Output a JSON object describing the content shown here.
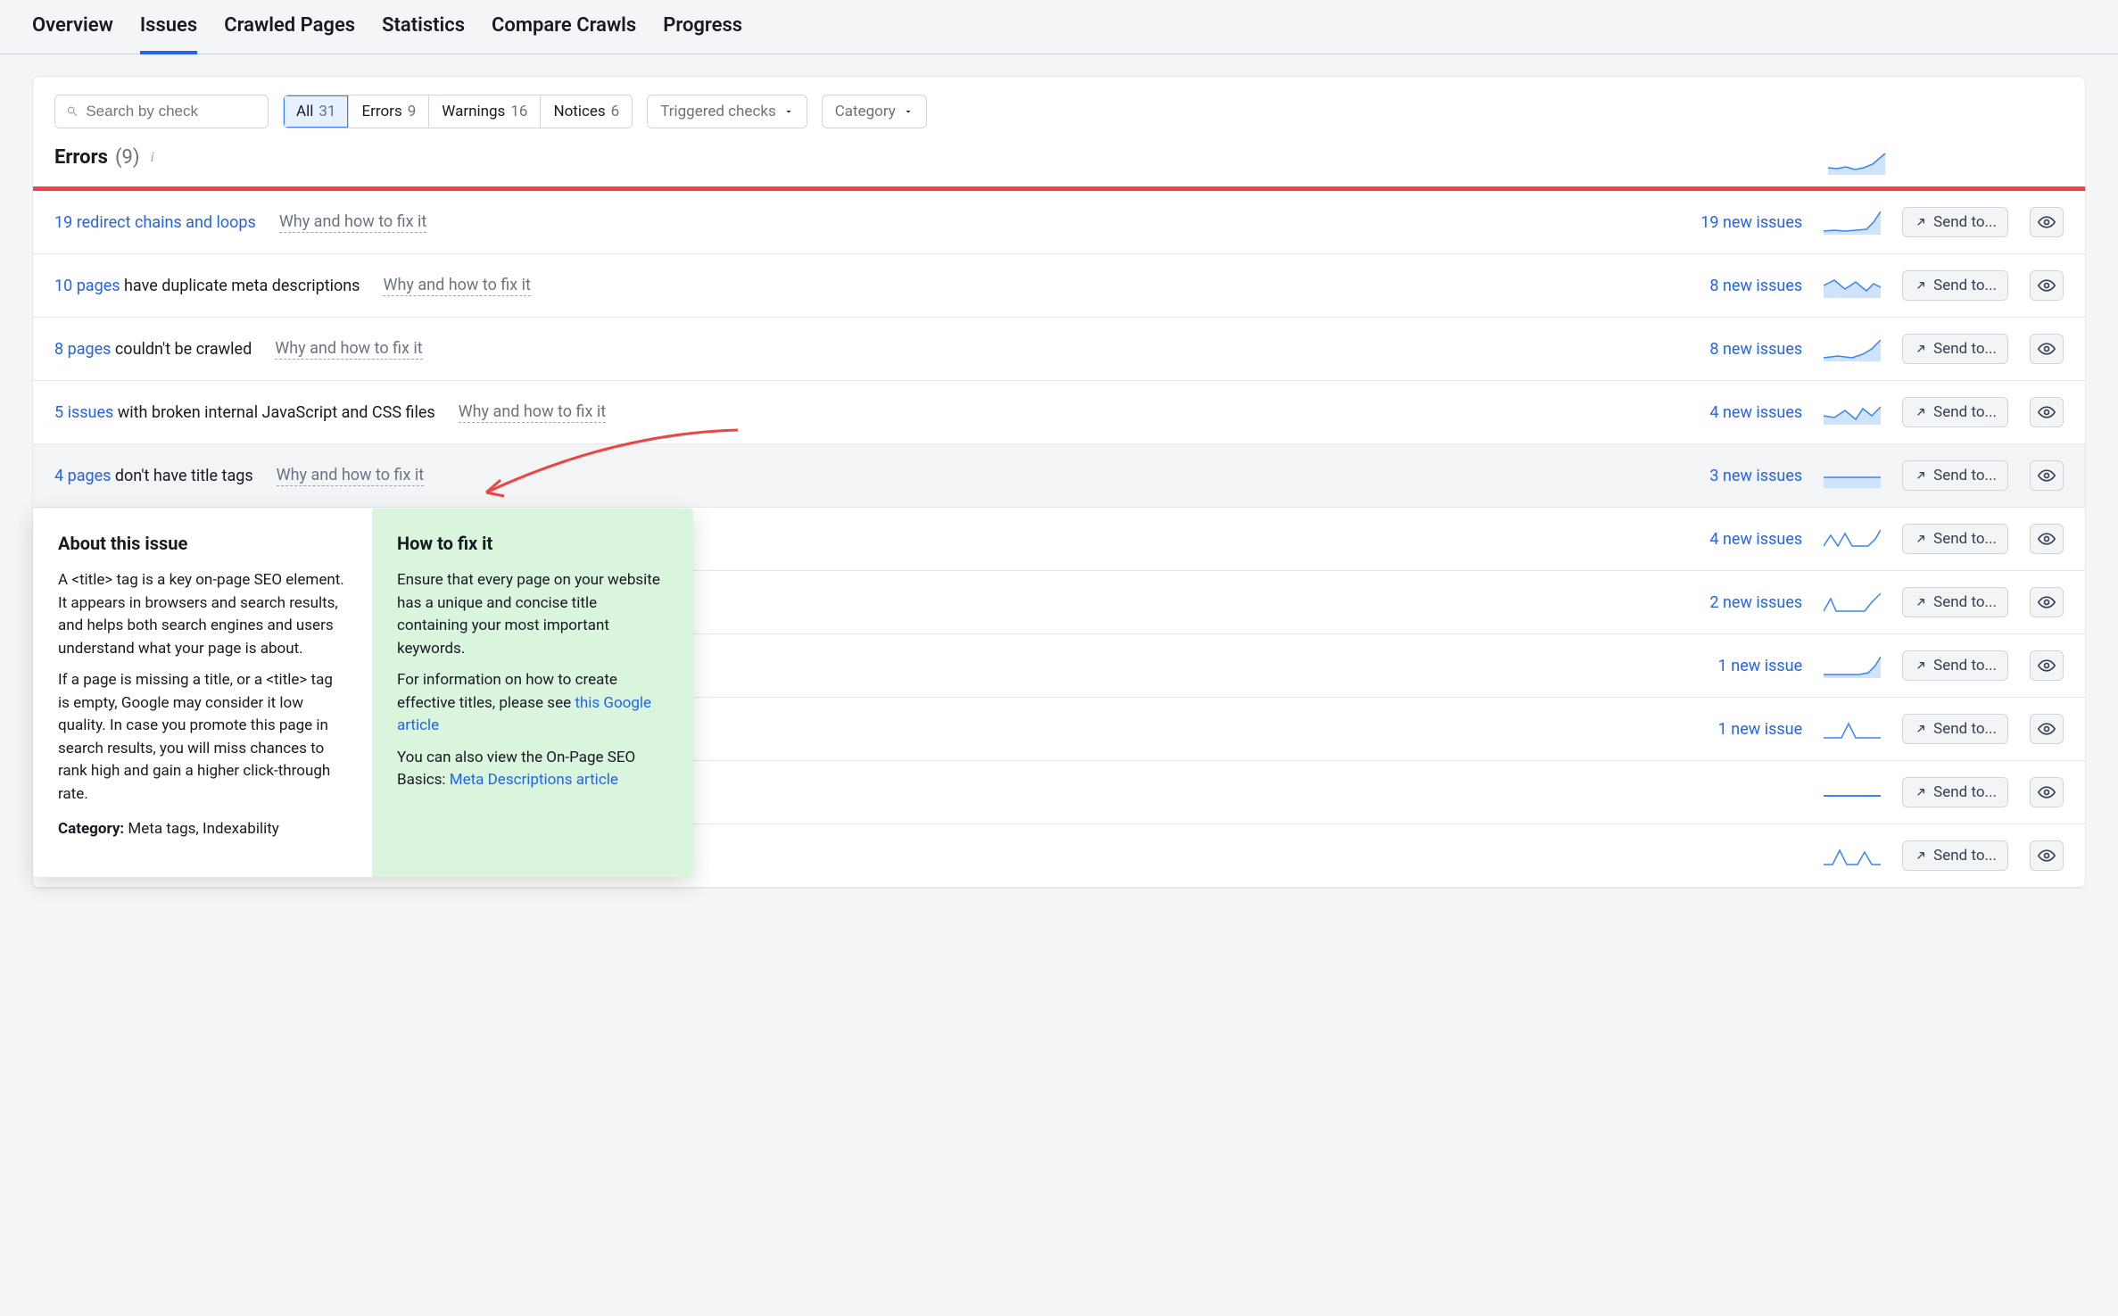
{
  "tabs": [
    "Overview",
    "Issues",
    "Crawled Pages",
    "Statistics",
    "Compare Crawls",
    "Progress"
  ],
  "active_tab": 1,
  "search": {
    "placeholder": "Search by check"
  },
  "filters": {
    "pills": [
      {
        "label": "All",
        "count": "31"
      },
      {
        "label": "Errors",
        "count": "9"
      },
      {
        "label": "Warnings",
        "count": "16"
      },
      {
        "label": "Notices",
        "count": "6"
      }
    ],
    "active_pill": 0,
    "dropdowns": [
      {
        "label": "Triggered checks"
      },
      {
        "label": "Category"
      }
    ]
  },
  "section": {
    "title": "Errors",
    "count": "(9)",
    "info": "i"
  },
  "rows": [
    {
      "link": "19 redirect chains and loops",
      "desc": "",
      "why": "Why and how to fix it",
      "new": "19 new issues"
    },
    {
      "link": "10 pages",
      "desc": "have duplicate meta descriptions",
      "why": "Why and how to fix it",
      "new": "8 new issues"
    },
    {
      "link": "8 pages",
      "desc": "couldn't be crawled",
      "why": "Why and how to fix it",
      "new": "8 new issues"
    },
    {
      "link": "5 issues",
      "desc": "with broken internal JavaScript and CSS files",
      "why": "Why and how to fix it",
      "new": "4 new issues"
    },
    {
      "link": "4 pages",
      "desc": "don't have title tags",
      "why": "Why and how to fix it",
      "new": "3 new issues",
      "highlight": true
    },
    {
      "link": "",
      "desc": "",
      "why": "",
      "new": "4 new issues"
    },
    {
      "link": "",
      "desc": "",
      "why": "",
      "new": "2 new issues"
    },
    {
      "link": "",
      "desc": "",
      "why": "",
      "new": "1 new issue"
    },
    {
      "link": "",
      "desc": "",
      "why": "",
      "new": "1 new issue"
    },
    {
      "link": "",
      "desc": "",
      "why": "",
      "new": ""
    },
    {
      "link": "",
      "desc": "",
      "why": "",
      "new": ""
    }
  ],
  "sendto": "Send to...",
  "popover": {
    "about_title": "About this issue",
    "about_p1": "A <title> tag is a key on-page SEO element. It appears in browsers and search results, and helps both search engines and users understand what your page is about.",
    "about_p2": "If a page is missing a title, or a <title> tag is empty, Google may consider it low quality. In case you promote this page in search results, you will miss chances to rank high and gain a higher click-through rate.",
    "about_cat_label": "Category:",
    "about_cat_val": "Meta tags, Indexability",
    "fix_title": "How to fix it",
    "fix_p1": "Ensure that every page on your website has a unique and concise title containing your most important keywords.",
    "fix_p2_a": "For information on how to create effective titles, please see ",
    "fix_p2_link": "this Google article",
    "fix_p3_a": "You can also view the On-Page SEO Basics: ",
    "fix_p3_link": "Meta Descriptions article"
  }
}
